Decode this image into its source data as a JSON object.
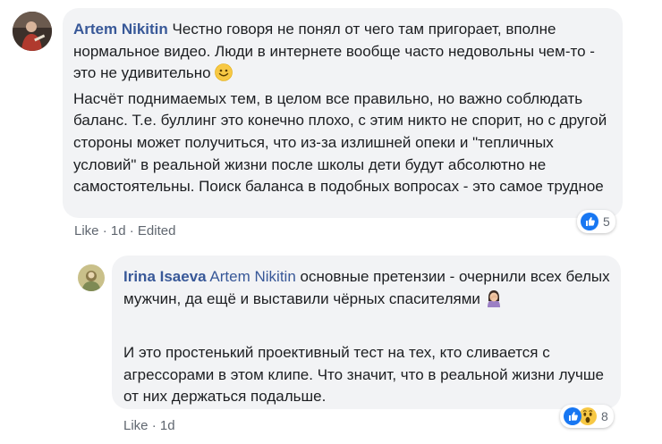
{
  "comments": [
    {
      "author": "Artem Nikitin",
      "paragraphs": [
        "Честно говоря не понял от чего там пригорает, вполне нормальное видео. Люди в интернете вообще часто недовольны чем-то - это не удивительно",
        "Насчёт поднимаемых тем, в целом все правильно, но важно соблюдать баланс. Т.е. буллинг это конечно плохо, с этим никто не спорит, но с другой стороны может получиться, что из-за излишней опеки и \"тепличных условий\" в реальной жизни после школы дети будут абсолютно не самостоятельны. Поиск баланса в подобных вопросах - это самое трудное"
      ],
      "actions": {
        "like": "Like",
        "sep1": "·",
        "time": "1d",
        "sep2": "·",
        "edited": "Edited"
      },
      "reaction_count": "5"
    },
    {
      "author": "Irina Isaeva",
      "mention": "Artem Nikitin",
      "paragraphs": [
        "основные претензии - очернили всех белых мужчин, да ещё и выставили чёрных спасителями",
        "И это простенький проективный тест на тех, кто сливается с агрессорами в этом клипе. Что значит, что в реальной жизни лучше от них держаться подальше."
      ],
      "actions": {
        "like": "Like",
        "sep1": "·",
        "time": "1d"
      },
      "reaction_count": "8"
    }
  ],
  "icons": {
    "smile": "smiling-face-icon",
    "facepalm": "woman-facepalming-icon",
    "like_reaction": "thumbs-up-reaction-icon",
    "wow_reaction": "wow-face-reaction-icon"
  },
  "colors": {
    "name": "#385898",
    "bubble": "#f2f3f5",
    "like_blue": "#1877f2",
    "meta": "#606770"
  }
}
